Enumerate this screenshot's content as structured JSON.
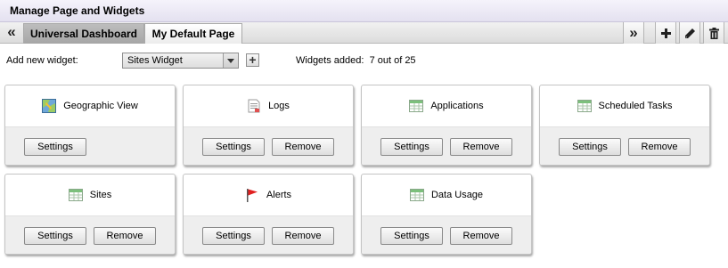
{
  "window": {
    "title": "Manage Page and Widgets"
  },
  "tabs": [
    {
      "label": "Universal Dashboard",
      "active": true
    },
    {
      "label": "My Default Page",
      "active": false
    }
  ],
  "toolbar": {
    "add_label": "Add new widget:",
    "selected_widget": "Sites Widget",
    "widgets_added_label": "Widgets added:",
    "widgets_added_value": "7 out of 25"
  },
  "widgets": [
    {
      "title": "Geographic View",
      "icon": "map-icon",
      "settings_label": "Settings",
      "remove_label": ""
    },
    {
      "title": "Logs",
      "icon": "log-document-icon",
      "settings_label": "Settings",
      "remove_label": "Remove"
    },
    {
      "title": "Applications",
      "icon": "table-icon",
      "settings_label": "Settings",
      "remove_label": "Remove"
    },
    {
      "title": "Scheduled Tasks",
      "icon": "table-icon",
      "settings_label": "Settings",
      "remove_label": "Remove"
    },
    {
      "title": "Sites",
      "icon": "table-icon",
      "settings_label": "Settings",
      "remove_label": "Remove"
    },
    {
      "title": "Alerts",
      "icon": "red-flag-icon",
      "settings_label": "Settings",
      "remove_label": "Remove"
    },
    {
      "title": "Data Usage",
      "icon": "table-icon",
      "settings_label": "Settings",
      "remove_label": "Remove"
    }
  ],
  "colors": {
    "title_bar": "#e4e1f0",
    "active_tab": "#a6a6a6",
    "card_footer": "#eeeeee",
    "flag": "#e02020",
    "table_header": "#7cc07c"
  }
}
